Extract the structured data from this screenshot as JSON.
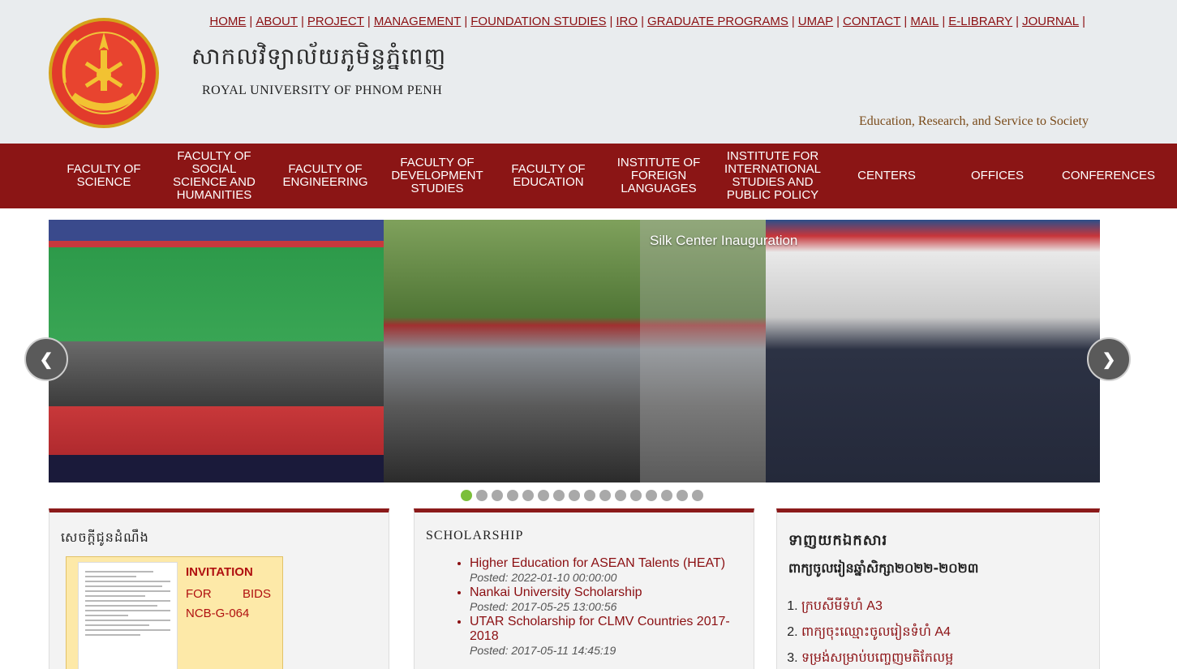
{
  "header": {
    "title_km": "សាកលវិទ្យាល័យភូមិន្ទភ្នំពេញ",
    "title_en": "ROYAL UNIVERSITY OF PHNOM PENH",
    "slogan": "Education, Research, and Service to Society",
    "colors": {
      "header_bg": "#e9ecee",
      "brand_red": "#8b1515"
    }
  },
  "topnav": [
    "HOME",
    "ABOUT",
    "PROJECT",
    "MANAGEMENT",
    "FOUNDATION STUDIES",
    "IRO",
    "GRADUATE PROGRAMS",
    "UMAP",
    "CONTACT",
    "MAIL",
    "E-LIBRARY",
    "JOURNAL"
  ],
  "mainmenu": [
    "Faculty of Science",
    "Faculty of Social Science and Humanities",
    "Faculty of Engineering",
    "Faculty of Development Studies",
    "Faculty of Education",
    "Institute of Foreign Languages",
    "Institute for International Studies and Public Policy",
    "Centers",
    "Offices",
    "Conferences"
  ],
  "slider": {
    "caption": "Silk Center Inauguration",
    "prev_icon": "chevron-left-icon",
    "next_icon": "chevron-right-icon",
    "prev_glyph": "❮",
    "next_glyph": "❯",
    "dots_total": 16,
    "active_dot": 1
  },
  "notice": {
    "title": "សេចក្តីជូនដំណឹង",
    "item_title": "INVITATION",
    "item_subtitle": "FOR BIDS NCB-G-064"
  },
  "scholarship": {
    "title": "SCHOLARSHIP",
    "items": [
      {
        "label": "Higher Education for ASEAN Talents (HEAT)",
        "posted": "Posted: 2022-01-10 00:00:00"
      },
      {
        "label": "Nankai University Scholarship",
        "posted": "Posted: 2017-05-25 13:00:56"
      },
      {
        "label": "UTAR Scholarship for CLMV Countries 2017-2018",
        "posted": "Posted: 2017-05-11 14:45:19"
      }
    ]
  },
  "downloads": {
    "title": "ទាញយកឯកសារ",
    "subtitle": "ពាក្យចូលរៀនឆ្នាំសិក្សា២០២២-២០២៣",
    "items": [
      "ក្របសីមីទំហំ A3",
      "ពាក្យចុះឈ្មោះចូលរៀនទំហំ A4",
      "ទម្រង់សម្រាប់បញ្ចេញមតិកែលម្អ"
    ]
  }
}
